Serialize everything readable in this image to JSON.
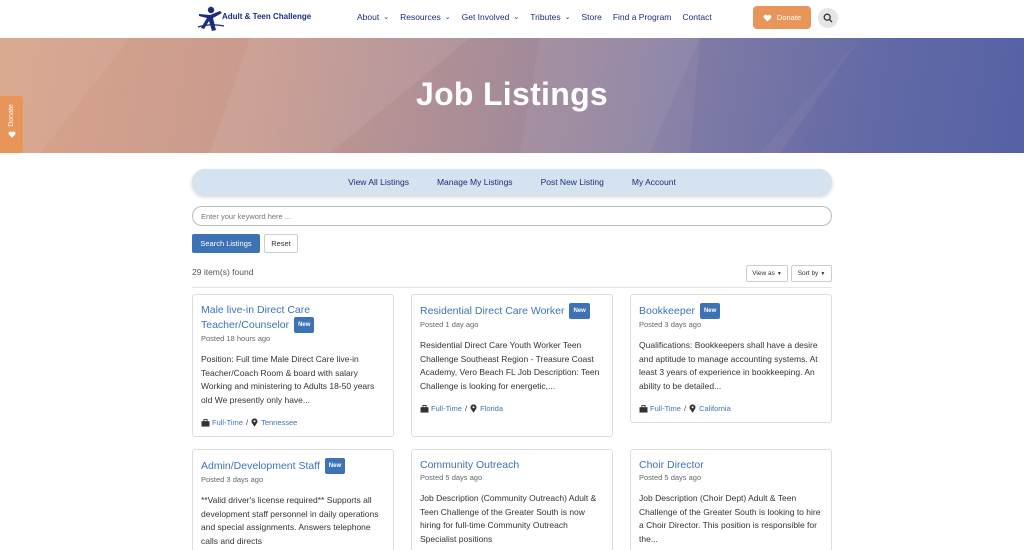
{
  "header": {
    "logo_text": "Adult & Teen Challenge",
    "nav": [
      {
        "label": "About",
        "dropdown": true
      },
      {
        "label": "Resources",
        "dropdown": true
      },
      {
        "label": "Get Involved",
        "dropdown": true
      },
      {
        "label": "Tributes",
        "dropdown": true
      },
      {
        "label": "Store",
        "dropdown": false
      },
      {
        "label": "Find a Program",
        "dropdown": false
      },
      {
        "label": "Contact",
        "dropdown": false
      }
    ],
    "donate_label": "Donate"
  },
  "banner": {
    "title": "Job Listings"
  },
  "side_donate_label": "Donate",
  "listing_nav": {
    "view_all": "View All Listings",
    "manage": "Manage My Listings",
    "post_new": "Post New Listing",
    "account": "My Account"
  },
  "search": {
    "placeholder": "Enter your keyword here ...",
    "search_label": "Search Listings",
    "reset_label": "Reset"
  },
  "results": {
    "count": "29 item(s) found",
    "view_as": "View as",
    "sort_by": "Sort by"
  },
  "cards": [
    {
      "title": "Male live-in Direct Care Teacher/Counselor",
      "badge": "New",
      "posted": "Posted 18 hours ago",
      "description": "Position: Full time Male Direct Care live-in Teacher/Coach Room & board with salary Working and ministering to Adults 18-50 years old We presently only have...",
      "type": "Full-Time",
      "location": "Tennessee"
    },
    {
      "title": "Residential Direct Care Worker",
      "badge": "New",
      "posted": "Posted 1 day ago",
      "description": "Residential Direct Care Youth Worker Teen Challenge Southeast Region  - Treasure Coast Academy, Vero Beach FL   Job Description: Teen Challenge is looking for energetic,...",
      "type": "Full-Time",
      "location": "Florida"
    },
    {
      "title": "Bookkeeper",
      "badge": "New",
      "posted": "Posted 3 days ago",
      "description": "Qualifications: Bookkeepers shall have a desire and aptitude to manage accounting systems. At least 3 years of experience in bookkeeping. An ability to be detailed...",
      "type": "Full-Time",
      "location": "California"
    },
    {
      "title": "Admin/Development Staff",
      "badge": "New",
      "posted": "Posted 3 days ago",
      "description": "**Valid driver's license required** Supports all development staff personnel in daily operations and special assignments. Answers telephone calls and directs",
      "type": "",
      "location": ""
    },
    {
      "title": "Community Outreach",
      "badge": "",
      "posted": "Posted 5 days ago",
      "description": "Job Description (Community Outreach) Adult & Teen Challenge of the Greater South is now hiring for full-time Community Outreach Specialist positions",
      "type": "",
      "location": ""
    },
    {
      "title": "Choir Director",
      "badge": "",
      "posted": "Posted 5 days ago",
      "description": "Job Description (Choir Dept) Adult & Teen Challenge of the Greater South is looking to hire a Choir Director. This position is responsible for the...",
      "type": "",
      "location": ""
    }
  ],
  "colors": {
    "navy": "#1a2d7a",
    "link_blue": "#3d73b5",
    "donate_orange": "#e8955a"
  }
}
